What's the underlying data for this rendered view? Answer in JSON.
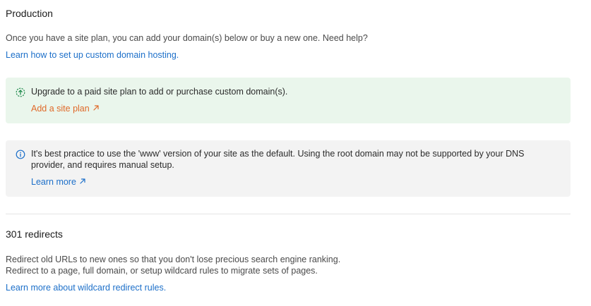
{
  "production": {
    "title": "Production",
    "description": "Once you have a site plan, you can add your domain(s) below or buy a new one. Need help?",
    "help_link": "Learn how to set up custom domain hosting."
  },
  "upgrade_notice": {
    "icon": "upgrade-arrow-circle-icon",
    "message": "Upgrade to a paid site plan to add or purchase custom domain(s).",
    "action_label": "Add a site plan",
    "action_icon": "external-arrow-icon",
    "accent_color": "#e06a2a",
    "background": "#eaf6ec"
  },
  "www_notice": {
    "icon": "info-icon",
    "message": "It's best practice to use the 'www' version of your site as the default. Using the root domain may not be supported by your DNS provider, and requires manual setup.",
    "action_label": "Learn more",
    "action_icon": "external-arrow-icon",
    "background": "#f3f3f3"
  },
  "redirects": {
    "title": "301 redirects",
    "description_line1": "Redirect old URLs to new ones so that you don't lose precious search engine ranking.",
    "description_line2": "Redirect to a page, full domain, or setup wildcard rules to migrate sets of pages.",
    "help_link": "Learn more about wildcard redirect rules."
  },
  "colors": {
    "link": "#1c6fc9",
    "success_icon": "#1f8a4c",
    "info_icon": "#1c6fc9"
  }
}
